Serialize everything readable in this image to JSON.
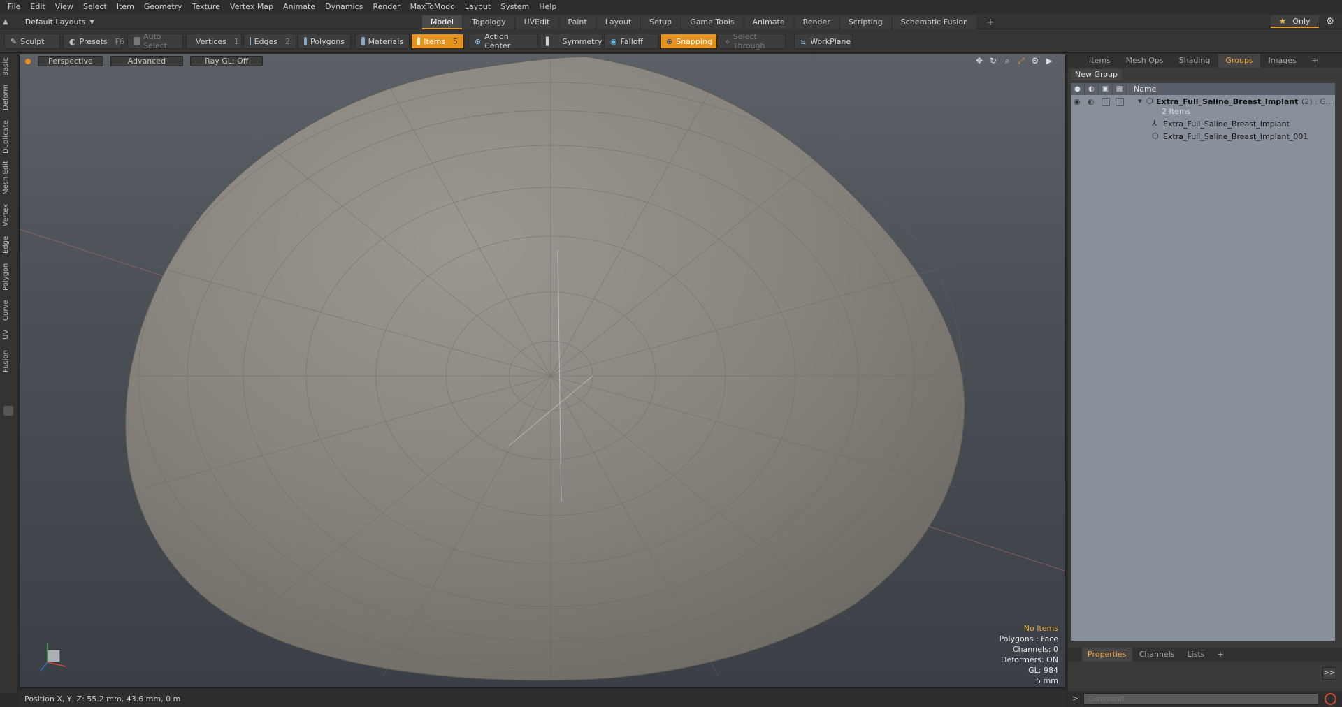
{
  "menu": [
    "File",
    "Edit",
    "View",
    "Select",
    "Item",
    "Geometry",
    "Texture",
    "Vertex Map",
    "Animate",
    "Dynamics",
    "Render",
    "MaxToModo",
    "Layout",
    "System",
    "Help"
  ],
  "layout": {
    "label": "Default Layouts"
  },
  "tabs": [
    "Model",
    "Topology",
    "UVEdit",
    "Paint",
    "Layout",
    "Setup",
    "Game Tools",
    "Animate",
    "Render",
    "Scripting",
    "Schematic Fusion"
  ],
  "only_label": "Only",
  "toolbar": {
    "sculpt": "Sculpt",
    "presets": "Presets",
    "presets_key": "F6",
    "auto_select": "Auto Select",
    "vertices": "Vertices",
    "vertices_num": "1",
    "edges": "Edges",
    "edges_num": "2",
    "polygons": "Polygons",
    "materials": "Materials",
    "items": "Items",
    "items_num": "5",
    "action_center": "Action Center",
    "symmetry": "Symmetry",
    "falloff": "Falloff",
    "snapping": "Snapping",
    "select_through": "Select Through",
    "workplane": "WorkPlane"
  },
  "lefttabs": [
    "Basic",
    "Deform",
    "Duplicate",
    "Mesh Edit",
    "Vertex",
    "Edge",
    "Polygon",
    "Curve",
    "UV",
    "Fusion"
  ],
  "viewport": {
    "view": "Perspective",
    "mode": "Advanced",
    "raygl": "Ray GL: Off",
    "stats": {
      "items": "No Items",
      "polygons": "Polygons : Face",
      "channels": "Channels: 0",
      "deformers": "Deformers: ON",
      "gl": "GL: 984",
      "scale": "5 mm"
    }
  },
  "rpanel": {
    "tabs": [
      "Items",
      "Mesh Ops",
      "Shading",
      "Groups",
      "Images"
    ],
    "active_tab": "Groups",
    "new_group": "New Group",
    "name_header": "Name",
    "group_name": "Extra_Full_Saline_Breast_Implant",
    "group_suffix": "(2) : G...",
    "group_count": "2 Items",
    "child1": "Extra_Full_Saline_Breast_Implant",
    "child2": "Extra_Full_Saline_Breast_Implant_001",
    "bottom_tabs": [
      "Properties",
      "Channels",
      "Lists"
    ]
  },
  "status": {
    "position": "Position X, Y, Z:   55.2 mm, 43.6 mm, 0 m"
  },
  "command": {
    "placeholder": "Command"
  },
  "colors": {
    "accent": "#e6921e",
    "tree_bg": "#878f9a",
    "viewport_top": "#5b6166"
  }
}
